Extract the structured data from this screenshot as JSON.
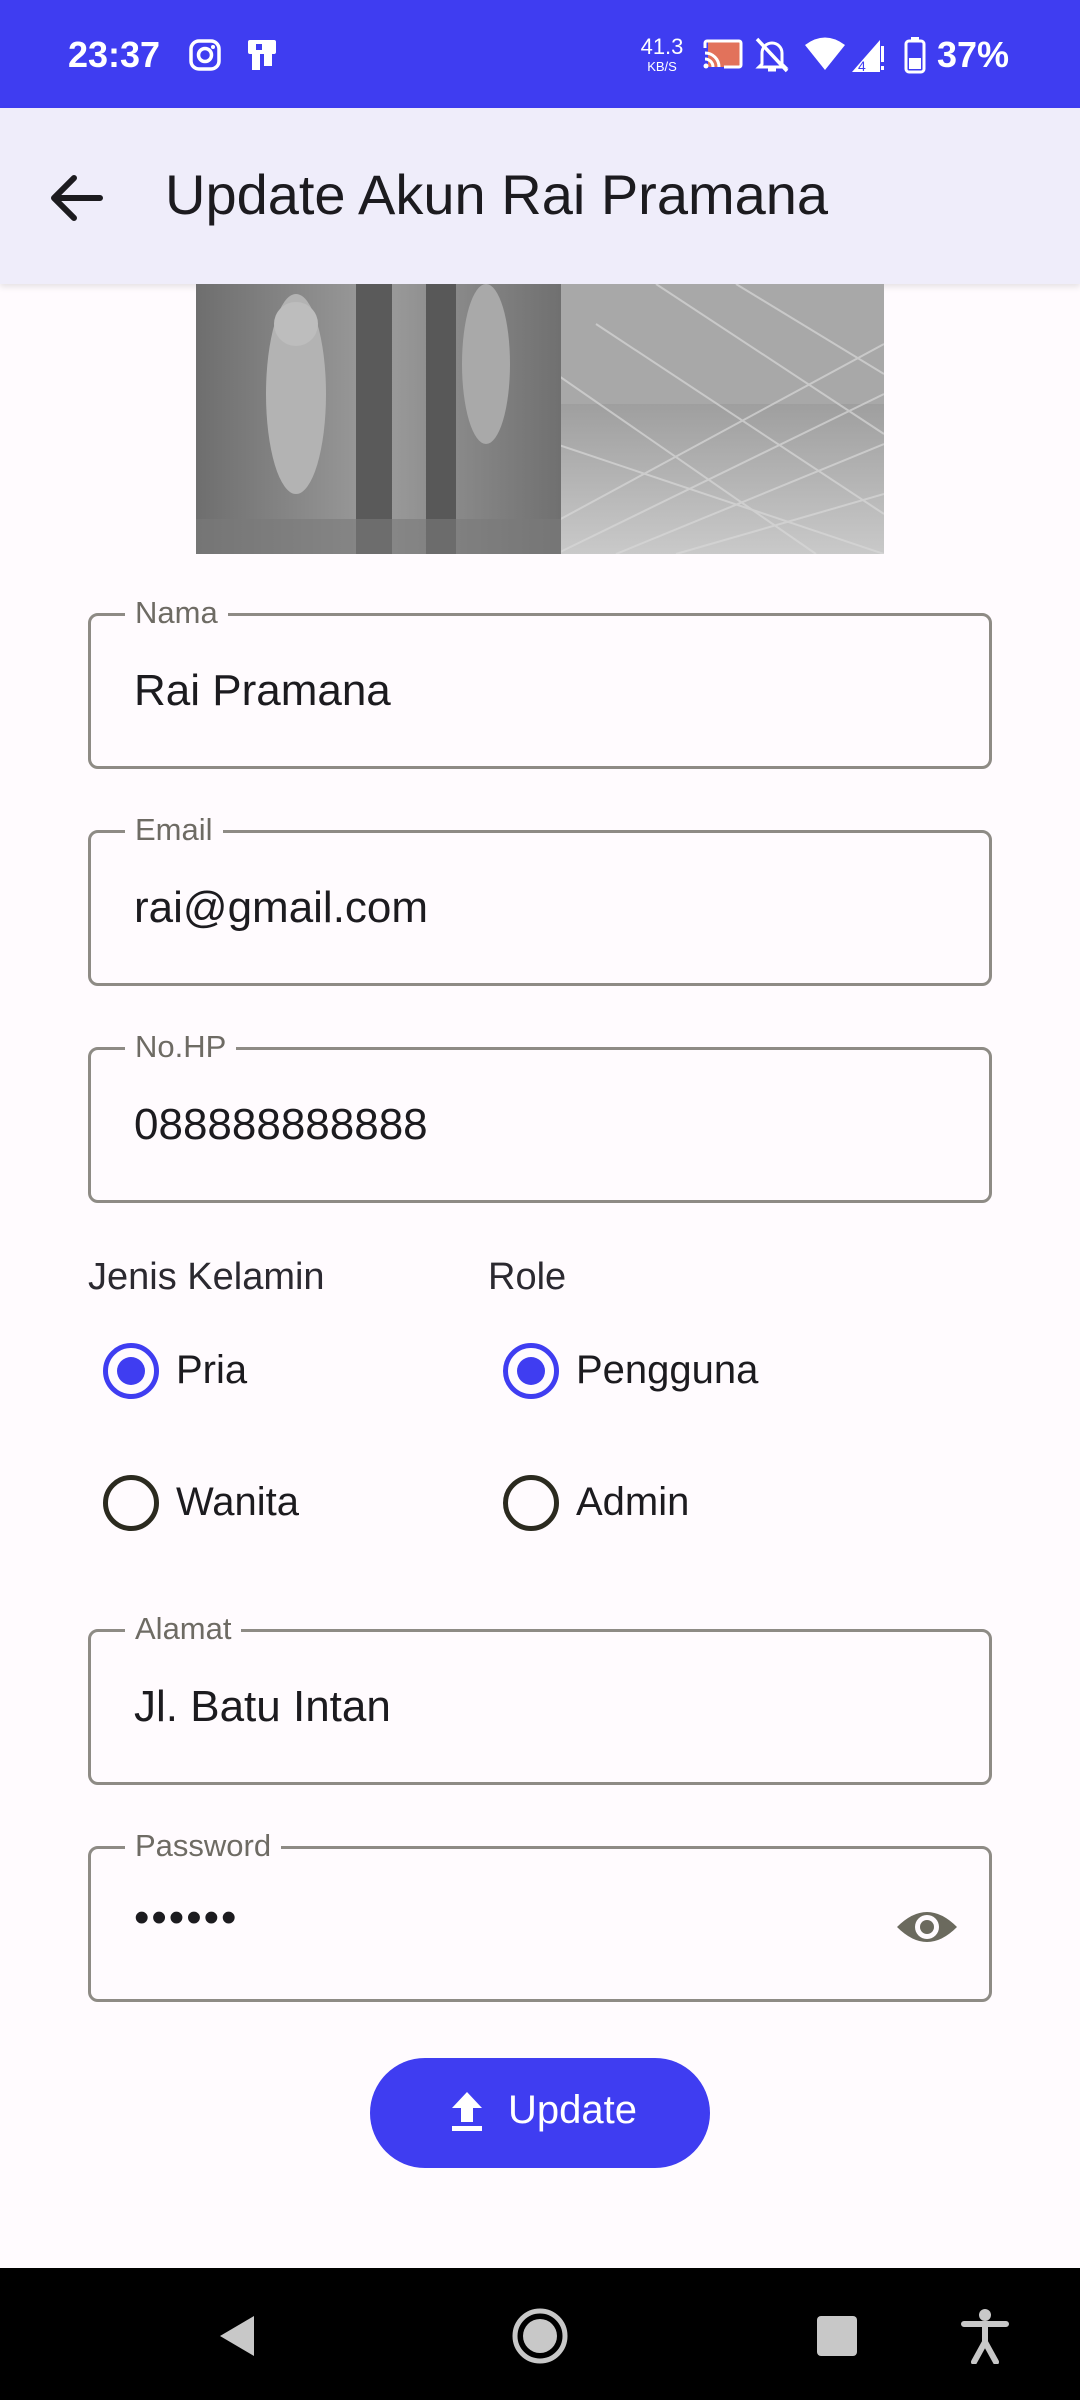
{
  "status_bar": {
    "time": "23:37",
    "net_speed_value": "41.3",
    "net_speed_unit": "KB/S",
    "battery_percent": "37%",
    "icons": [
      "instagram-icon",
      "notification-app-icon",
      "cast-icon",
      "mute-icon",
      "wifi-icon",
      "signal-icon",
      "battery-icon"
    ]
  },
  "app_bar": {
    "title": "Update Akun Rai Pramana",
    "back_icon": "arrow-back-icon"
  },
  "form": {
    "nama": {
      "label": "Nama",
      "value": "Rai Pramana"
    },
    "email": {
      "label": "Email",
      "value": "rai@gmail.com"
    },
    "no_hp": {
      "label": "No.HP",
      "value": "088888888888"
    },
    "jenis_kelamin": {
      "label": "Jenis Kelamin",
      "options": [
        {
          "label": "Pria",
          "selected": true
        },
        {
          "label": "Wanita",
          "selected": false
        }
      ]
    },
    "role": {
      "label": "Role",
      "options": [
        {
          "label": "Pengguna",
          "selected": true
        },
        {
          "label": "Admin",
          "selected": false
        }
      ]
    },
    "alamat": {
      "label": "Alamat",
      "value": "Jl. Batu Intan"
    },
    "password": {
      "label": "Password",
      "value": "••••••",
      "toggle_icon": "eye-icon"
    }
  },
  "update_button": {
    "label": "Update",
    "icon": "upload-icon"
  },
  "colors": {
    "primary": "#3F3DF1",
    "app_bar_bg": "#EFEDFA",
    "background": "#FFFBFE"
  },
  "nav_bar": {
    "icons": [
      "back-triangle-icon",
      "home-circle-icon",
      "recents-square-icon",
      "accessibility-icon"
    ]
  }
}
